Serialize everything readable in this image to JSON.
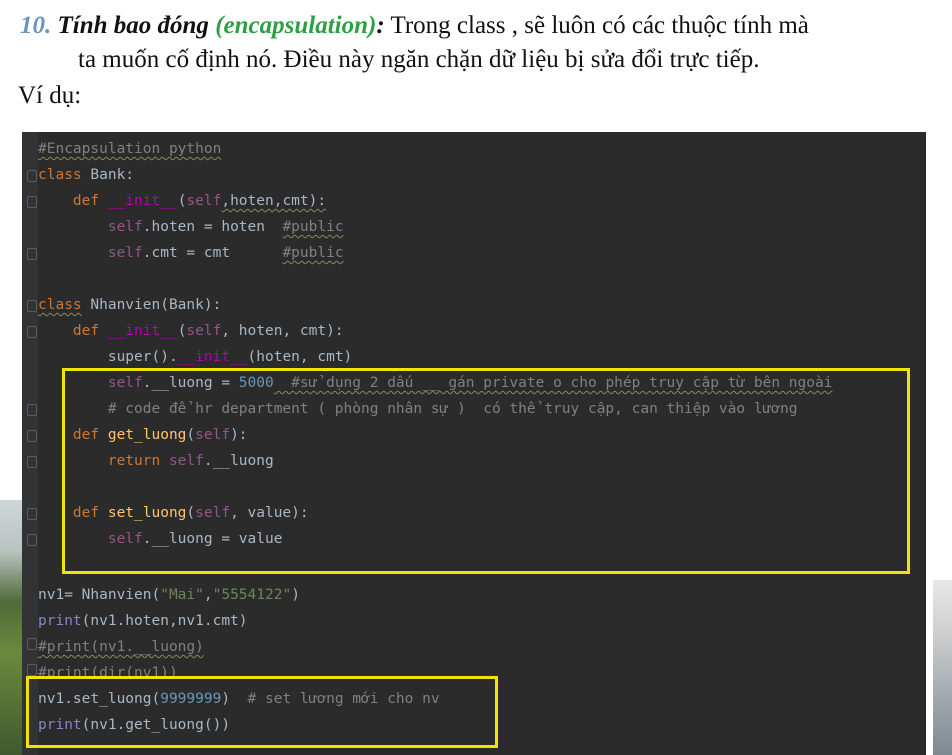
{
  "heading": {
    "number": "10.",
    "term": "Tính bao đóng",
    "paren": "(encapsulation)",
    "colon": ":",
    "text1": " Trong class , sẽ luôn có các thuộc tính mà",
    "text2": "ta muốn cố định nó. Điều này ngăn chặn dữ liệu bị sửa đổi trực tiếp.",
    "example": "Ví dụ:"
  },
  "code": {
    "l1": "#Encapsulation python",
    "l2_kw": "class",
    "l2_rest": " Bank:",
    "l3_kw": "    def ",
    "l3_fn": "__init__",
    "l3_p1": "(",
    "l3_self": "self",
    "l3_p2": ",hoten,cmt):",
    "l4_self": "        self",
    "l4_rest": ".hoten = hoten  ",
    "l4_cmt": "#public",
    "l5_self": "        self",
    "l5_rest": ".cmt = cmt      ",
    "l5_cmt": "#public",
    "l7_kw": "class",
    "l7_rest": " Nhanvien(Bank):",
    "l8_kw": "    def ",
    "l8_fn": "__init__",
    "l8_p1": "(",
    "l8_self": "self",
    "l8_p2": ", hoten, cmt):",
    "l9_a": "        super().",
    "l9_fn": "__init__",
    "l9_b": "(hoten, cmt)",
    "l10_self": "        self",
    "l10_rest": ".__luong = ",
    "l10_num": "5000",
    "l10_cmt": "  #sử dụng 2 dấu __ gán private o cho phép truy cập từ bên ngoài",
    "l11_cmt": "        # code để hr department ( phòng nhân sự )  có thể truy cập, can thiệp vào lương",
    "l12_kw": "    def ",
    "l12_fn": "get_luong",
    "l12_p1": "(",
    "l12_self": "self",
    "l12_p2": "):",
    "l13_kw": "        return ",
    "l13_self": "self",
    "l13_rest": ".__luong",
    "l15_kw": "    def ",
    "l15_fn": "set_luong",
    "l15_p1": "(",
    "l15_self": "self",
    "l15_p2": ", value):",
    "l16_self": "        self",
    "l16_rest": ".__luong = value",
    "l18_a": "nv1= Nhanvien(",
    "l18_s1": "\"Mai\"",
    "l18_c": ",",
    "l18_s2": "\"5554122\"",
    "l18_b": ")",
    "l19_fn": "print",
    "l19_rest": "(nv1.hoten,nv1.cmt)",
    "l20_cmt": "#print(nv1.__luong)",
    "l21_cmt": "#print(dir(nv1))",
    "l22_a": "nv1.set_luong(",
    "l22_num": "9999999",
    "l22_b": ")  ",
    "l22_cmt": "# set lương mới cho nv",
    "l23_fn": "print",
    "l23_rest": "(nv1.get_luong())"
  },
  "colors": {
    "highlight": "#f2e400",
    "editor_bg": "#2b2b2b",
    "heading_accent": "#2ea043"
  }
}
